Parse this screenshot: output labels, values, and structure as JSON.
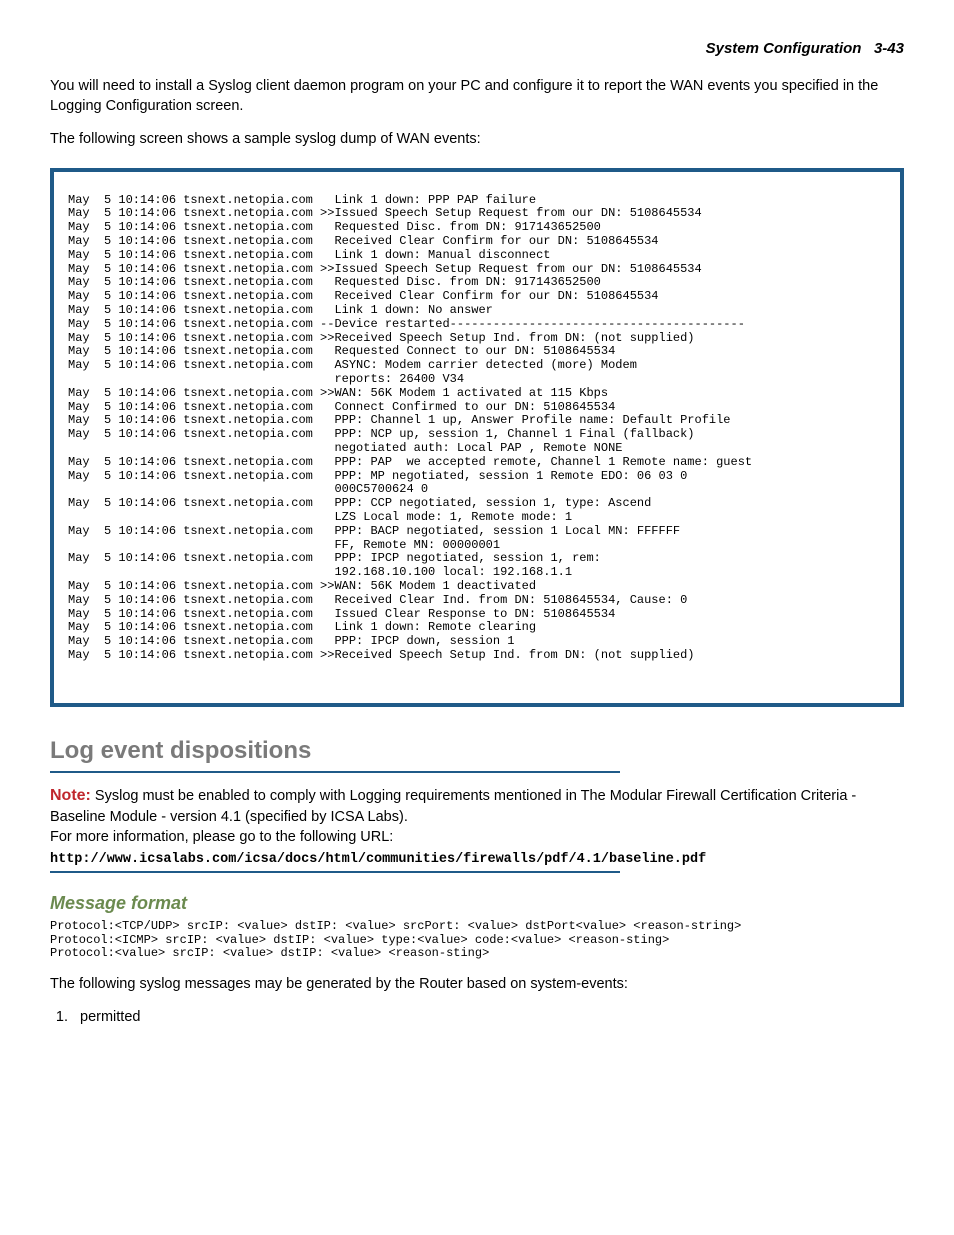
{
  "header": {
    "section": "System Configuration",
    "page": "3-43"
  },
  "paragraphs": {
    "intro1": "You will need to install a Syslog client daemon program on your PC and configure it to report the WAN events you specified in the Logging Configuration screen.",
    "intro2": "The following screen shows a sample syslog dump of WAN events:",
    "afterFormat": "The following syslog messages may be generated by the Router based on system-events:"
  },
  "syslog": "May  5 10:14:06 tsnext.netopia.com   Link 1 down: PPP PAP failure \nMay  5 10:14:06 tsnext.netopia.com >>Issued Speech Setup Request from our DN: 5108645534 \nMay  5 10:14:06 tsnext.netopia.com   Requested Disc. from DN: 917143652500 \nMay  5 10:14:06 tsnext.netopia.com   Received Clear Confirm for our DN: 5108645534 \nMay  5 10:14:06 tsnext.netopia.com   Link 1 down: Manual disconnect \nMay  5 10:14:06 tsnext.netopia.com >>Issued Speech Setup Request from our DN: 5108645534 \nMay  5 10:14:06 tsnext.netopia.com   Requested Disc. from DN: 917143652500 \nMay  5 10:14:06 tsnext.netopia.com   Received Clear Confirm for our DN: 5108645534 \nMay  5 10:14:06 tsnext.netopia.com   Link 1 down: No answer \nMay  5 10:14:06 tsnext.netopia.com --Device restarted----------------------------------------- \nMay  5 10:14:06 tsnext.netopia.com >>Received Speech Setup Ind. from DN: (not supplied) \nMay  5 10:14:06 tsnext.netopia.com   Requested Connect to our DN: 5108645534 \nMay  5 10:14:06 tsnext.netopia.com   ASYNC: Modem carrier detected (more) Modem \n                                     reports: 26400 V34\nMay  5 10:14:06 tsnext.netopia.com >>WAN: 56K Modem 1 activated at 115 Kbps \nMay  5 10:14:06 tsnext.netopia.com   Connect Confirmed to our DN: 5108645534 \nMay  5 10:14:06 tsnext.netopia.com   PPP: Channel 1 up, Answer Profile name: Default Profile \nMay  5 10:14:06 tsnext.netopia.com   PPP: NCP up, session 1, Channel 1 Final (fallback) \n                                     negotiated auth: Local PAP , Remote NONE\nMay  5 10:14:06 tsnext.netopia.com   PPP: PAP  we accepted remote, Channel 1 Remote name: guest \nMay  5 10:14:06 tsnext.netopia.com   PPP: MP negotiated, session 1 Remote EDO: 06 03 0 \n                                     000C5700624 0\nMay  5 10:14:06 tsnext.netopia.com   PPP: CCP negotiated, session 1, type: Ascend \n                                     LZS Local mode: 1, Remote mode: 1\nMay  5 10:14:06 tsnext.netopia.com   PPP: BACP negotiated, session 1 Local MN: FFFFFF \n                                     FF, Remote MN: 00000001\nMay  5 10:14:06 tsnext.netopia.com   PPP: IPCP negotiated, session 1, rem: \n                                     192.168.10.100 local: 192.168.1.1\nMay  5 10:14:06 tsnext.netopia.com >>WAN: 56K Modem 1 deactivated \nMay  5 10:14:06 tsnext.netopia.com   Received Clear Ind. from DN: 5108645534, Cause: 0 \nMay  5 10:14:06 tsnext.netopia.com   Issued Clear Response to DN: 5108645534 \nMay  5 10:14:06 tsnext.netopia.com   Link 1 down: Remote clearing \nMay  5 10:14:06 tsnext.netopia.com   PPP: IPCP down, session 1 \nMay  5 10:14:06 tsnext.netopia.com >>Received Speech Setup Ind. from DN: (not supplied)",
  "sections": {
    "logEventTitle": "Log event dispositions",
    "noteLabel": "Note:",
    "noteBody1": "Syslog must be enabled to comply with Logging requirements mentioned in The Modular Firewall Certification Criteria - Baseline Module - version 4.1 (specified by ICSA Labs).",
    "noteBody2": "For more information, please go to the following URL:",
    "url": "http://www.icsalabs.com/icsa/docs/html/communities/firewalls/pdf/4.1/baseline.pdf",
    "msgFormatTitle": "Message format",
    "msgFormatBlock": "Protocol:<TCP/UDP> srcIP: <value> dstIP: <value> srcPort: <value> dstPort<value> <reason-string>\nProtocol:<ICMP> srcIP: <value> dstIP: <value> type:<value> code:<value> <reason-sting>\nProtocol:<value> srcIP: <value> dstIP: <value> <reason-sting>"
  },
  "eventsList": {
    "item1": "permitted"
  }
}
